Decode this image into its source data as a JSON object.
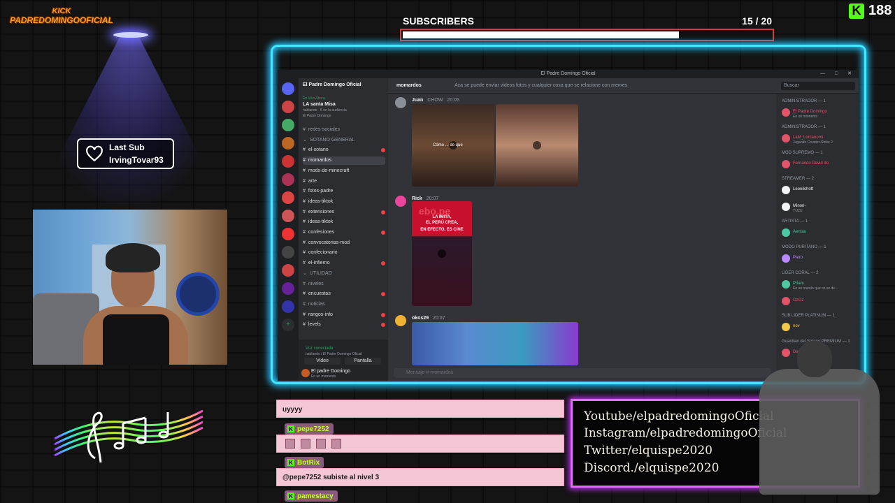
{
  "kick_overlay": {
    "line1": "KICK",
    "line2": "PADREDOMINGOOFICIAL"
  },
  "subscribers_goal": {
    "label": "SUBSCRIBERS",
    "count_text": "15 / 20",
    "current": 15,
    "target": 20
  },
  "kick_followers": {
    "logo_letter": "K",
    "count": "188"
  },
  "last_sub": {
    "title": "Last Sub",
    "username": "IrvingTovar93"
  },
  "discord": {
    "window_title": "El Padre Domingo Oficial",
    "server_name": "El Padre Domingo Oficial",
    "live_box": {
      "label": "En Vivo Ahora",
      "title": "LA santa Misa",
      "sub": "hablando · 5 en la audiencia",
      "host": "El Padre Domingo"
    },
    "channels": [
      {
        "name": "redes-sociales",
        "state": "muted",
        "unread": false
      },
      {
        "name": "SOTANO GENERAL",
        "state": "category",
        "unread": false
      },
      {
        "name": "el-sotano",
        "state": "bright",
        "unread": true
      },
      {
        "name": "momardos",
        "state": "active",
        "unread": false
      },
      {
        "name": "mods-de-minecraft",
        "state": "bright",
        "unread": false
      },
      {
        "name": "arte",
        "state": "bright",
        "unread": false
      },
      {
        "name": "fotos-padre",
        "state": "bright",
        "unread": false
      },
      {
        "name": "ideas-tiktok",
        "state": "bright",
        "unread": false
      },
      {
        "name": "extensiones",
        "state": "bright",
        "unread": true
      },
      {
        "name": "ideas-tiktok",
        "state": "bright",
        "unread": false
      },
      {
        "name": "confesiones",
        "state": "bright",
        "unread": true
      },
      {
        "name": "convocatorias-mod",
        "state": "bright",
        "unread": false
      },
      {
        "name": "confecionario",
        "state": "bright",
        "unread": false
      },
      {
        "name": "el-infierno",
        "state": "bright",
        "unread": true
      },
      {
        "name": "UTILIDAD",
        "state": "category",
        "unread": false
      },
      {
        "name": "niveles",
        "state": "muted",
        "unread": false
      },
      {
        "name": "encuestas",
        "state": "bright",
        "unread": true
      },
      {
        "name": "noticias",
        "state": "muted",
        "unread": false
      },
      {
        "name": "rangos-info",
        "state": "bright",
        "unread": true
      },
      {
        "name": "levels",
        "state": "bright",
        "unread": true
      }
    ],
    "voice": {
      "status": "Voz conectada",
      "sub": "hablando / El Padre Domingo Oficial",
      "video_btn": "Video",
      "screen_btn": "Pantalla"
    },
    "user": {
      "name": "El padre Domingo",
      "status": "En un momento"
    },
    "header": {
      "channel": "momardos",
      "topic": "Aca se puede enviar videos fotos y cualquier cosa que se relacione con memes",
      "search_placeholder": "Buscar"
    },
    "messages": [
      {
        "author": "Juan",
        "tag": "CHOW",
        "time": "20:05"
      },
      {
        "author": "Rick",
        "tag": "",
        "time": "20:07"
      },
      {
        "author": "okos29",
        "tag": "",
        "time": "20:07"
      }
    ],
    "media_text": {
      "video1": "Cómo ... de que",
      "video3_line1": "LA IMITA,",
      "video3_line2": "EL PERÚ CREA,",
      "video3_line3": "EN EFECTO, ES CINE",
      "video3_brand": "ebo.pe"
    },
    "input_placeholder": "Mensaje # momardos",
    "members": [
      {
        "kind": "role",
        "label": "ADMINISTRADOR — 1"
      },
      {
        "kind": "member",
        "name": "El Padre Domingo",
        "sub": "En un momento",
        "color": "#e0556a"
      },
      {
        "kind": "role",
        "label": "ADMINISTRADOR — 1"
      },
      {
        "kind": "member",
        "name": "LaM_Lorcanomi",
        "sub": "Jugando Counter-Strike 2",
        "color": "#e0556a"
      },
      {
        "kind": "role",
        "label": "MOD SUPREMO — 1"
      },
      {
        "kind": "member",
        "name": "Fernando David do",
        "sub": "",
        "color": "#e0556a"
      },
      {
        "kind": "role",
        "label": "STREAMER — 2"
      },
      {
        "kind": "member",
        "name": "Leonilshott",
        "sub": "",
        "color": "#f2f3f5"
      },
      {
        "kind": "member",
        "name": "Minori-",
        "sub": "YUZU",
        "color": "#f2f3f5"
      },
      {
        "kind": "role",
        "label": "ARTISTA — 1"
      },
      {
        "kind": "member",
        "name": "Aentau",
        "sub": "",
        "color": "#4ec9a5"
      },
      {
        "kind": "role",
        "label": "MODO PURITANO — 1"
      },
      {
        "kind": "member",
        "name": "Piero",
        "sub": "",
        "color": "#b889ff"
      },
      {
        "kind": "role",
        "label": "LIDER CORAL — 2"
      },
      {
        "kind": "member",
        "name": "Priam",
        "sub": "En un mundo que no se de...",
        "color": "#4ec9a5"
      },
      {
        "kind": "member",
        "name": "OzOz",
        "sub": "",
        "color": "#e0556a"
      },
      {
        "kind": "role",
        "label": "SUB LIDER PLATINUM — 1"
      },
      {
        "kind": "member",
        "name": "nov",
        "sub": "",
        "color": "#f0c84a"
      },
      {
        "kind": "role",
        "label": "Guardian del Sotano PREMIUM — 1"
      },
      {
        "kind": "member",
        "name": "Dana 09",
        "sub": "",
        "color": "#e0556a"
      }
    ]
  },
  "chat": {
    "messages": [
      {
        "user": "",
        "text": "uyyyy"
      },
      {
        "user": "pepe7252",
        "text": ""
      },
      {
        "user": "BotRix",
        "text": "@pepe7252 subiste al nivel 3"
      },
      {
        "user": "pamestacy",
        "text": ""
      }
    ]
  },
  "socials": [
    "Youtube/elpadredomingoOficial",
    "Instagram/elpadredomingoOficial",
    "Twitter/elquispe2020",
    "Discord./elquispe2020"
  ],
  "colors": {
    "neon_cyan": "#42e8ff",
    "neon_pink": "#e66aff",
    "kick_green": "#53fc18",
    "kick_orange": "#f4a11c",
    "goal_border": "#d63d3d",
    "chat_pink": "#f5c6d6"
  }
}
